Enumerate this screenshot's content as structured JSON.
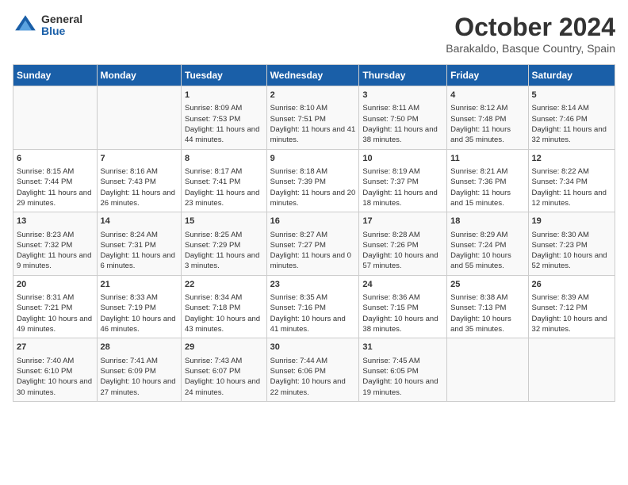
{
  "logo": {
    "general": "General",
    "blue": "Blue"
  },
  "title": "October 2024",
  "subtitle": "Barakaldo, Basque Country, Spain",
  "days_of_week": [
    "Sunday",
    "Monday",
    "Tuesday",
    "Wednesday",
    "Thursday",
    "Friday",
    "Saturday"
  ],
  "weeks": [
    [
      {
        "day": "",
        "info": ""
      },
      {
        "day": "",
        "info": ""
      },
      {
        "day": "1",
        "info": "Sunrise: 8:09 AM\nSunset: 7:53 PM\nDaylight: 11 hours and 44 minutes."
      },
      {
        "day": "2",
        "info": "Sunrise: 8:10 AM\nSunset: 7:51 PM\nDaylight: 11 hours and 41 minutes."
      },
      {
        "day": "3",
        "info": "Sunrise: 8:11 AM\nSunset: 7:50 PM\nDaylight: 11 hours and 38 minutes."
      },
      {
        "day": "4",
        "info": "Sunrise: 8:12 AM\nSunset: 7:48 PM\nDaylight: 11 hours and 35 minutes."
      },
      {
        "day": "5",
        "info": "Sunrise: 8:14 AM\nSunset: 7:46 PM\nDaylight: 11 hours and 32 minutes."
      }
    ],
    [
      {
        "day": "6",
        "info": "Sunrise: 8:15 AM\nSunset: 7:44 PM\nDaylight: 11 hours and 29 minutes."
      },
      {
        "day": "7",
        "info": "Sunrise: 8:16 AM\nSunset: 7:43 PM\nDaylight: 11 hours and 26 minutes."
      },
      {
        "day": "8",
        "info": "Sunrise: 8:17 AM\nSunset: 7:41 PM\nDaylight: 11 hours and 23 minutes."
      },
      {
        "day": "9",
        "info": "Sunrise: 8:18 AM\nSunset: 7:39 PM\nDaylight: 11 hours and 20 minutes."
      },
      {
        "day": "10",
        "info": "Sunrise: 8:19 AM\nSunset: 7:37 PM\nDaylight: 11 hours and 18 minutes."
      },
      {
        "day": "11",
        "info": "Sunrise: 8:21 AM\nSunset: 7:36 PM\nDaylight: 11 hours and 15 minutes."
      },
      {
        "day": "12",
        "info": "Sunrise: 8:22 AM\nSunset: 7:34 PM\nDaylight: 11 hours and 12 minutes."
      }
    ],
    [
      {
        "day": "13",
        "info": "Sunrise: 8:23 AM\nSunset: 7:32 PM\nDaylight: 11 hours and 9 minutes."
      },
      {
        "day": "14",
        "info": "Sunrise: 8:24 AM\nSunset: 7:31 PM\nDaylight: 11 hours and 6 minutes."
      },
      {
        "day": "15",
        "info": "Sunrise: 8:25 AM\nSunset: 7:29 PM\nDaylight: 11 hours and 3 minutes."
      },
      {
        "day": "16",
        "info": "Sunrise: 8:27 AM\nSunset: 7:27 PM\nDaylight: 11 hours and 0 minutes."
      },
      {
        "day": "17",
        "info": "Sunrise: 8:28 AM\nSunset: 7:26 PM\nDaylight: 10 hours and 57 minutes."
      },
      {
        "day": "18",
        "info": "Sunrise: 8:29 AM\nSunset: 7:24 PM\nDaylight: 10 hours and 55 minutes."
      },
      {
        "day": "19",
        "info": "Sunrise: 8:30 AM\nSunset: 7:23 PM\nDaylight: 10 hours and 52 minutes."
      }
    ],
    [
      {
        "day": "20",
        "info": "Sunrise: 8:31 AM\nSunset: 7:21 PM\nDaylight: 10 hours and 49 minutes."
      },
      {
        "day": "21",
        "info": "Sunrise: 8:33 AM\nSunset: 7:19 PM\nDaylight: 10 hours and 46 minutes."
      },
      {
        "day": "22",
        "info": "Sunrise: 8:34 AM\nSunset: 7:18 PM\nDaylight: 10 hours and 43 minutes."
      },
      {
        "day": "23",
        "info": "Sunrise: 8:35 AM\nSunset: 7:16 PM\nDaylight: 10 hours and 41 minutes."
      },
      {
        "day": "24",
        "info": "Sunrise: 8:36 AM\nSunset: 7:15 PM\nDaylight: 10 hours and 38 minutes."
      },
      {
        "day": "25",
        "info": "Sunrise: 8:38 AM\nSunset: 7:13 PM\nDaylight: 10 hours and 35 minutes."
      },
      {
        "day": "26",
        "info": "Sunrise: 8:39 AM\nSunset: 7:12 PM\nDaylight: 10 hours and 32 minutes."
      }
    ],
    [
      {
        "day": "27",
        "info": "Sunrise: 7:40 AM\nSunset: 6:10 PM\nDaylight: 10 hours and 30 minutes."
      },
      {
        "day": "28",
        "info": "Sunrise: 7:41 AM\nSunset: 6:09 PM\nDaylight: 10 hours and 27 minutes."
      },
      {
        "day": "29",
        "info": "Sunrise: 7:43 AM\nSunset: 6:07 PM\nDaylight: 10 hours and 24 minutes."
      },
      {
        "day": "30",
        "info": "Sunrise: 7:44 AM\nSunset: 6:06 PM\nDaylight: 10 hours and 22 minutes."
      },
      {
        "day": "31",
        "info": "Sunrise: 7:45 AM\nSunset: 6:05 PM\nDaylight: 10 hours and 19 minutes."
      },
      {
        "day": "",
        "info": ""
      },
      {
        "day": "",
        "info": ""
      }
    ]
  ]
}
